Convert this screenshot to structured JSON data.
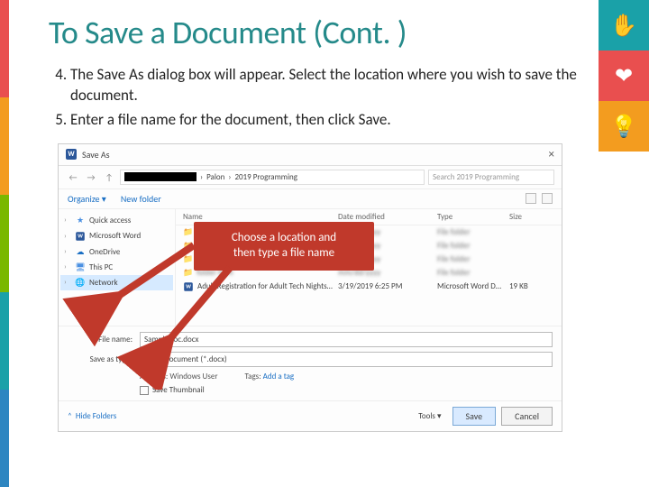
{
  "slide": {
    "title": "To Save a Document (Cont. )",
    "steps": [
      "The Save As dialog box will appear.  Select the location where you wish to save the document.",
      "Enter a file name for the document, then click Save."
    ],
    "startNumber": 4
  },
  "callout": {
    "line1": "Choose a location and",
    "line2": "then type a file name"
  },
  "dialog": {
    "title": "Save As",
    "breadcrumb": {
      "seg1": "Palon",
      "seg2": "2019 Programming"
    },
    "searchPlaceholder": "Search 2019 Programming",
    "toolbar": {
      "organize": "Organize ▾",
      "newFolder": "New folder"
    },
    "tree": [
      {
        "icon": "★",
        "label": "Quick access",
        "color": "#4a90e2"
      },
      {
        "icon": "W",
        "label": "Microsoft Word",
        "color": "#2b579a",
        "word": true
      },
      {
        "icon": "☁",
        "label": "OneDrive",
        "color": "#1a6fc4"
      },
      {
        "icon": "🖥",
        "label": "This PC",
        "color": "#4a90e2"
      },
      {
        "icon": "🌐",
        "label": "Network",
        "color": "#4a90e2",
        "selected": true
      }
    ],
    "columns": {
      "name": "Name",
      "date": "Date modified",
      "type": "Type",
      "size": "Size"
    },
    "rows": [
      {
        "name": "folder item",
        "type": "File folder"
      },
      {
        "name": "folder item",
        "type": "File folder"
      },
      {
        "name": "folder item",
        "type": "File folder"
      },
      {
        "name": "folder item",
        "type": "File folder"
      },
      {
        "name": "Adult Registration for Adult Tech Nights…",
        "date": "3/19/2019 6:25 PM",
        "type": "Microsoft Word D…",
        "size": "19 KB",
        "doc": true
      }
    ],
    "form": {
      "fileNameLabel": "File name:",
      "fileNameValue": "SampleDoc.docx",
      "saveTypeLabel": "Save as type:",
      "saveTypeValue": "Word Document (*.docx)",
      "authorsLabel": "Authors:",
      "authorsValue": "Windows User",
      "tagsLabel": "Tags:",
      "tagsValue": "Add a tag",
      "thumbnailLabel": "Save Thumbnail"
    },
    "footer": {
      "hideFolders": "Hide Folders",
      "tools": "Tools ▾",
      "save": "Save",
      "cancel": "Cancel"
    }
  },
  "badges": {
    "b1": "✋",
    "b2": "❤",
    "b3": "💡"
  }
}
